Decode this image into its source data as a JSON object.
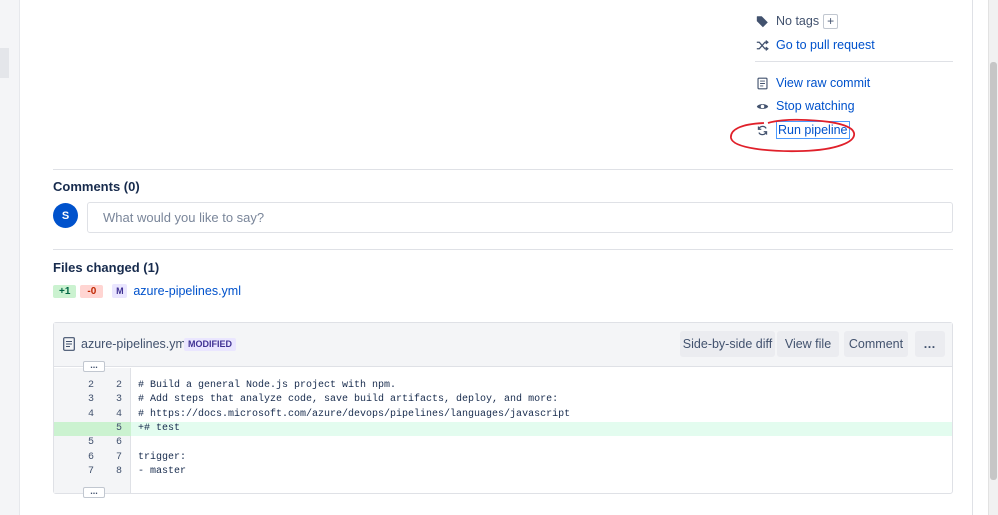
{
  "actions": {
    "no_tags": "No tags",
    "add_tag": "+",
    "go_to_pr": "Go to pull request",
    "view_raw": "View raw commit",
    "stop_watching": "Stop watching",
    "run_pipeline": "Run pipeline"
  },
  "comments": {
    "title": "Comments (0)",
    "avatar_initial": "S",
    "placeholder": "What would you like to say?"
  },
  "files": {
    "title": "Files changed (1)",
    "added": "+1",
    "removed": "-0",
    "status_letter": "M",
    "file_name": "azure-pipelines.yml"
  },
  "diff": {
    "file_name": "azure-pipelines.yml",
    "status": "MODIFIED",
    "buttons": {
      "side_by_side": "Side-by-side diff",
      "view_file": "View file",
      "comment": "Comment",
      "more": "…"
    },
    "expand_label": "...",
    "lines": [
      {
        "old": "2",
        "new": "2",
        "code": "# Build a general Node.js project with npm.",
        "type": "context"
      },
      {
        "old": "3",
        "new": "3",
        "code": "# Add steps that analyze code, save build artifacts, deploy, and more:",
        "type": "context"
      },
      {
        "old": "4",
        "new": "4",
        "code": "# https://docs.microsoft.com/azure/devops/pipelines/languages/javascript",
        "type": "context"
      },
      {
        "old": "",
        "new": "5",
        "code": "+# test",
        "type": "added"
      },
      {
        "old": "5",
        "new": "6",
        "code": "",
        "type": "context"
      },
      {
        "old": "6",
        "new": "7",
        "code": "trigger:",
        "type": "context"
      },
      {
        "old": "7",
        "new": "8",
        "code": "- master",
        "type": "context"
      }
    ]
  },
  "colors": {
    "link": "#0052cc",
    "added_bg": "#e3fcef",
    "annotation": "#e0202a"
  }
}
